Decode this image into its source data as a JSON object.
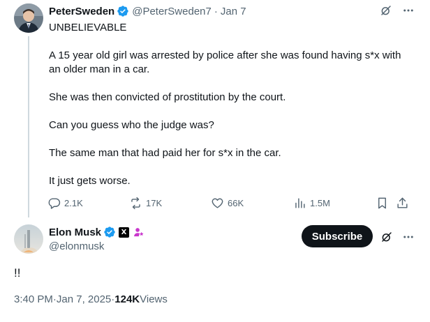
{
  "original_tweet": {
    "author_name": "PeterSweden",
    "handle": "@PeterSweden7",
    "separator": "·",
    "date": "Jan 7",
    "paragraphs": [
      "UNBELIEVABLE",
      "A 15 year old girl was arrested by police after she was found having s*x with an older man in a car.",
      "She was then convicted of prostitution by the court.",
      "Can you guess who the judge was?",
      "The same man that had paid her for s*x in the car.",
      "It just gets worse."
    ],
    "actions": {
      "replies": "2.1K",
      "reposts": "17K",
      "likes": "66K",
      "views": "1.5M"
    },
    "icons": {
      "grok": "grok-icon",
      "more": "more-icon",
      "verified": "verified-badge-icon",
      "reply": "reply-icon",
      "repost": "repost-icon",
      "like": "like-icon",
      "views": "views-icon",
      "bookmark": "bookmark-icon",
      "share": "share-icon"
    }
  },
  "reply_tweet": {
    "author_name": "Elon Musk",
    "handle": "@elonmusk",
    "affiliate_badge": "X",
    "subscribe_label": "Subscribe",
    "text": "!!",
    "time": "3:40 PM",
    "date": "Jan 7, 2025",
    "separator": "·",
    "views_count": "124K",
    "views_label": "Views",
    "icons": {
      "verified": "verified-badge-icon",
      "affiliate": "x-logo-icon",
      "parody": "purple-person-badge-icon",
      "grok": "grok-icon",
      "more": "more-icon"
    }
  },
  "colors": {
    "text_primary": "#0f1419",
    "text_secondary": "#536471",
    "verified_blue": "#1d9bf0",
    "thread_line": "#cfd9de",
    "button_dark": "#0f1419",
    "badge_purple": "#c936cc"
  }
}
